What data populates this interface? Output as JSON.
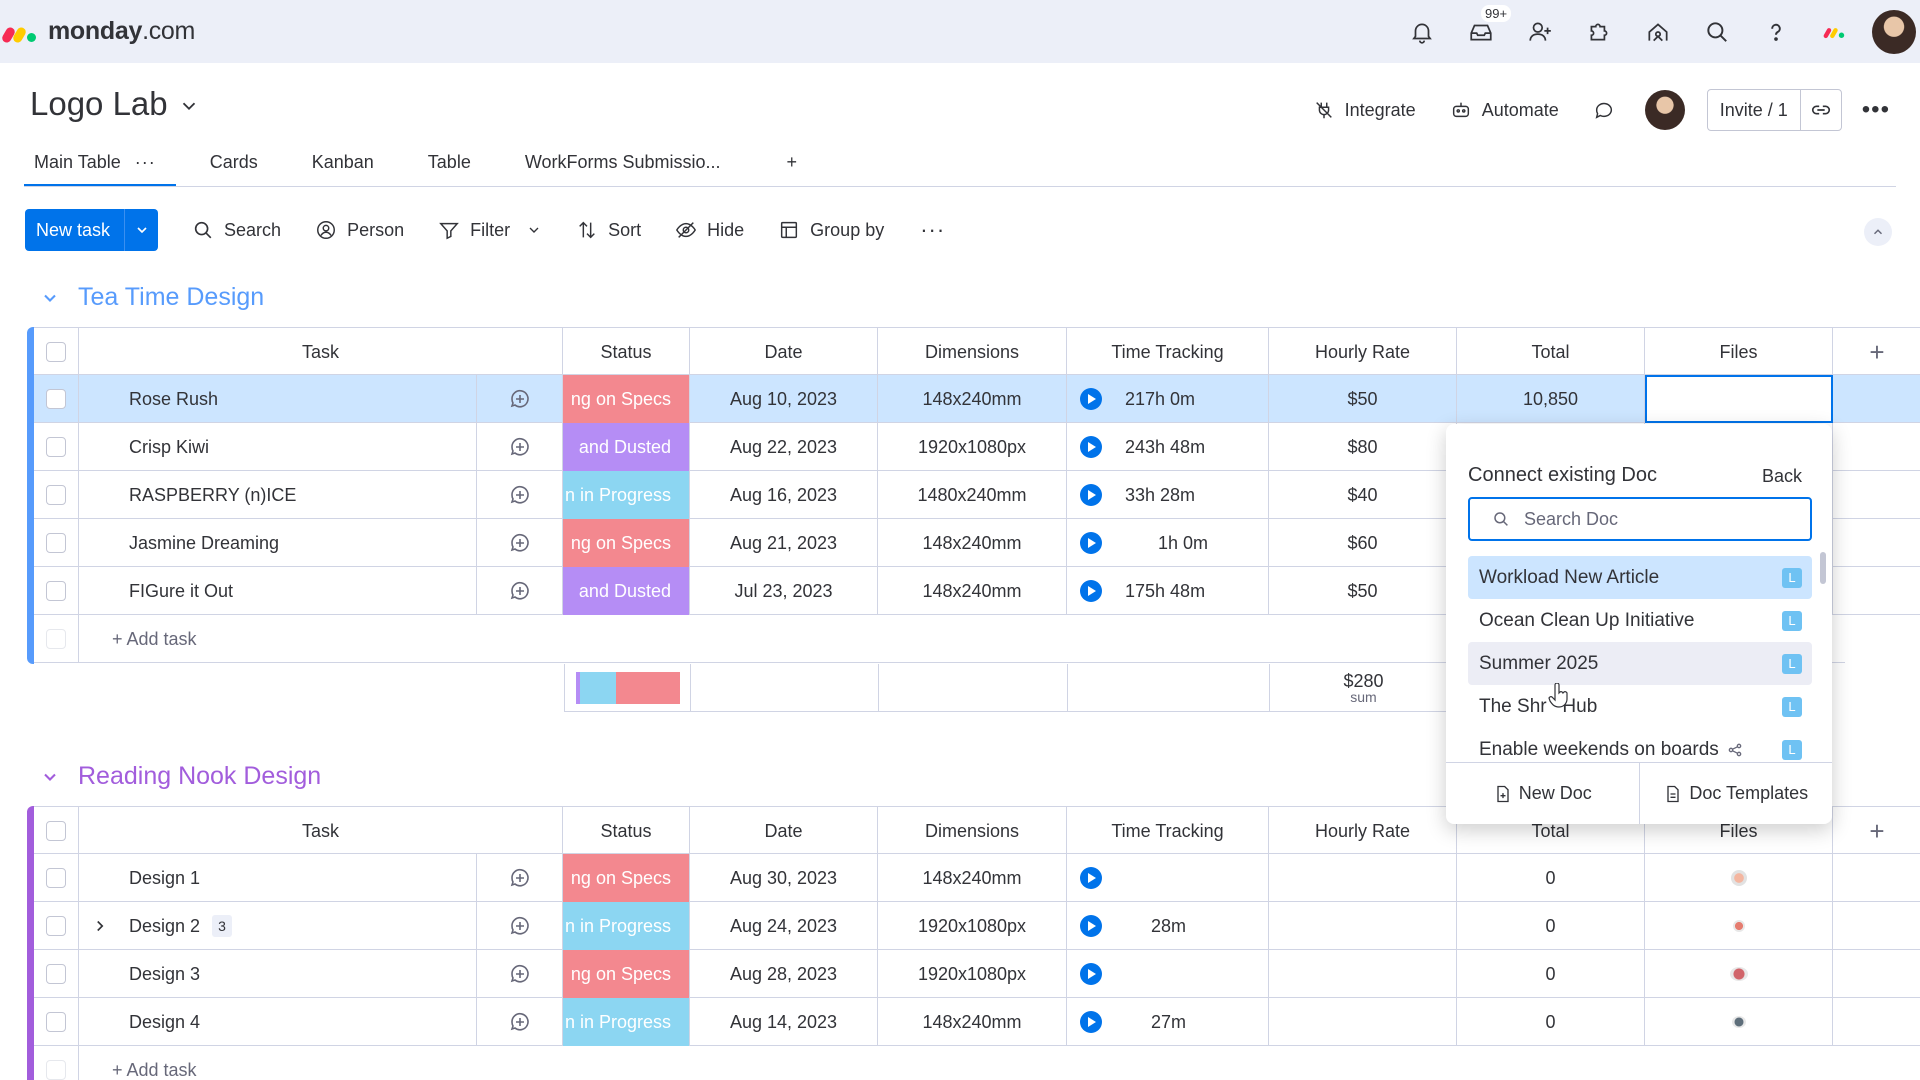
{
  "topbar": {
    "brand": "monday",
    "brand_suffix": ".com",
    "inbox_badge": "99+"
  },
  "board": {
    "title": "Logo Lab",
    "actions": {
      "integrate": "Integrate",
      "automate": "Automate",
      "invite": "Invite / 1"
    },
    "tabs": [
      {
        "label": "Main Table"
      },
      {
        "label": "Cards"
      },
      {
        "label": "Kanban"
      },
      {
        "label": "Table"
      },
      {
        "label": "WorkForms Submissio..."
      }
    ],
    "add_tab": "+"
  },
  "toolbar": {
    "new_task": "New task",
    "search": "Search",
    "person": "Person",
    "filter": "Filter",
    "sort": "Sort",
    "hide": "Hide",
    "group_by": "Group by"
  },
  "columns": {
    "task": "Task",
    "status": "Status",
    "date": "Date",
    "dimensions": "Dimensions",
    "time_tracking": "Time Tracking",
    "hourly_rate": "Hourly Rate",
    "total": "Total",
    "files": "Files"
  },
  "groups": [
    {
      "title": "Tea Time Design",
      "color": "#579bfc",
      "add_task": "+ Add task",
      "rows": [
        {
          "task": "Rose Rush",
          "status": "ng on Specs",
          "date": "Aug 10, 2023",
          "dimensions": "148x240mm",
          "time": "217h 0m",
          "rate": "$50",
          "total": "10,850"
        },
        {
          "task": "Crisp Kiwi",
          "status": "and Dusted",
          "date": "Aug 22, 2023",
          "dimensions": "1920x1080px",
          "time": "243h 48m",
          "rate": "$80",
          "total": ""
        },
        {
          "task": "RASPBERRY (n)ICE",
          "status": "n in Progress",
          "date": "Aug 16, 2023",
          "dimensions": "1480x240mm",
          "time": "33h 28m",
          "rate": "$40",
          "total": ""
        },
        {
          "task": "Jasmine Dreaming",
          "status": "ng on Specs",
          "date": "Aug 21, 2023",
          "dimensions": "148x240mm",
          "time": "1h 0m",
          "rate": "$60",
          "total": ""
        },
        {
          "task": "FIGure it Out",
          "status": "and Dusted",
          "date": "Jul 23, 2023",
          "dimensions": "148x240mm",
          "time": "175h 48m",
          "rate": "$50",
          "total": ""
        }
      ],
      "summary": {
        "rate_sum": "$280",
        "rate_sum_label": "sum"
      }
    },
    {
      "title": "Reading Nook Design",
      "color": "#a25ddc",
      "add_task": "+ Add task",
      "rows": [
        {
          "task": "Design 1",
          "status": "ng on Specs",
          "date": "Aug 30, 2023",
          "dimensions": "148x240mm",
          "time": "",
          "rate": "",
          "total": "0"
        },
        {
          "task": "Design 2",
          "subitems": "3",
          "status": "n in Progress",
          "date": "Aug 24, 2023",
          "dimensions": "1920x1080px",
          "time": "28m",
          "rate": "",
          "total": "0"
        },
        {
          "task": "Design 3",
          "status": "ng on Specs",
          "date": "Aug 28, 2023",
          "dimensions": "1920x1080px",
          "time": "",
          "rate": "",
          "total": "0"
        },
        {
          "task": "Design 4",
          "status": "n in Progress",
          "date": "Aug 14, 2023",
          "dimensions": "148x240mm",
          "time": "27m",
          "rate": "",
          "total": "0"
        }
      ]
    }
  ],
  "doc_dropdown": {
    "title": "Connect existing Doc",
    "back": "Back",
    "search_placeholder": "Search Doc",
    "items": [
      {
        "label": "Workload New Article",
        "badge": "L"
      },
      {
        "label": "Ocean Clean Up Initiative",
        "badge": "L"
      },
      {
        "label": "Summer 2025",
        "badge": "L"
      },
      {
        "label": "The Shr   Hub",
        "badge": "L"
      },
      {
        "label": "Enable weekends on boards",
        "badge": "L"
      }
    ],
    "new_doc": "New Doc",
    "doc_templates": "Doc Templates"
  }
}
